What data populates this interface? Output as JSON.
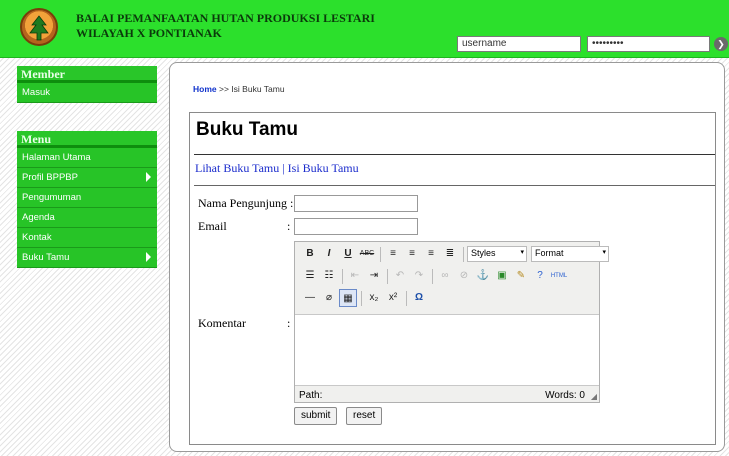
{
  "header": {
    "title_line1": "BALAI PEMANFAATAN HUTAN PRODUKSI LESTARI",
    "title_line2": "WILAYAH X PONTIANAK",
    "username_value": "username",
    "password_value": "•••••••••",
    "go_icon": "arrow-right-circle-icon"
  },
  "sidebar": {
    "member_heading": "Member",
    "member_items": [
      {
        "label": "Masuk"
      }
    ],
    "menu_heading": "Menu",
    "menu_items": [
      {
        "label": "Halaman Utama"
      },
      {
        "label": "Profil BPPBP",
        "has_submenu": true
      },
      {
        "label": "Pengumuman"
      },
      {
        "label": "Agenda"
      },
      {
        "label": "Kontak"
      },
      {
        "label": "Buku Tamu",
        "has_submenu": true
      }
    ]
  },
  "breadcrumb": {
    "home": "Home",
    "separator": ">>",
    "current": "Isi Buku Tamu"
  },
  "page": {
    "title": "Buku Tamu",
    "tab_view": "Lihat Buku Tamu",
    "tab_sep": "|",
    "tab_write": "Isi Buku Tamu"
  },
  "form": {
    "name_label": "Nama Pengunjung",
    "email_label": "Email",
    "comment_label": "Komentar",
    "colon": ":",
    "name_value": "",
    "email_value": "",
    "submit_label": "submit",
    "reset_label": "reset"
  },
  "editor": {
    "styles_label": "Styles",
    "format_label": "Format",
    "bold": "B",
    "italic": "I",
    "underline": "U",
    "strike": "ABC",
    "html": "HTML",
    "subscript": "x₂",
    "superscript": "x²",
    "special_char": "Ω",
    "path_label": "Path:",
    "words_label": "Words: 0"
  },
  "colors": {
    "header_green": "#2ce02c",
    "sidebar_green": "#27c427",
    "link_blue": "#1a2bcc"
  }
}
